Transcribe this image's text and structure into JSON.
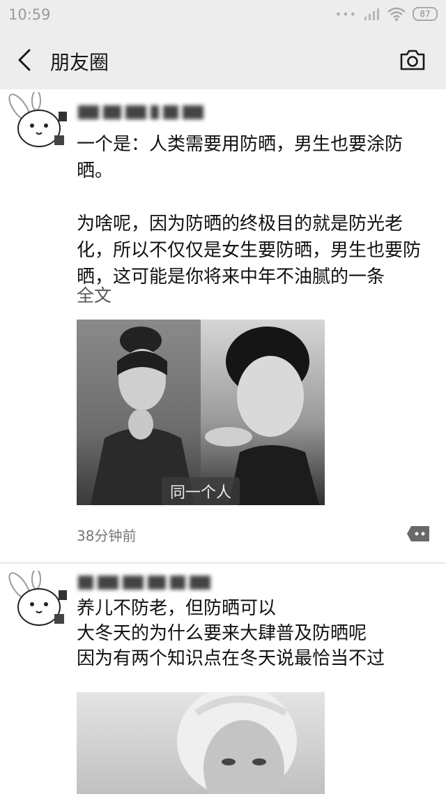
{
  "status": {
    "time": "10:59",
    "dots": "•••",
    "battery": "87"
  },
  "nav": {
    "title": "朋友圈"
  },
  "posts": [
    {
      "text": "一个是：人类需要用防晒，男生也要涂防晒。\n\n为啥呢，因为防晒的终极目的就是防光老化，所以不仅仅是女生要防晒，男生也要防晒，这可能是你将来中年不油腻的一条",
      "full_text_link": "全文",
      "image_caption": "同一个人",
      "time": "38分钟前"
    },
    {
      "text": "养儿不防老，但防晒可以\n大冬天的为什么要来大肆普及防晒呢\n因为有两个知识点在冬天说最恰当不过"
    }
  ]
}
